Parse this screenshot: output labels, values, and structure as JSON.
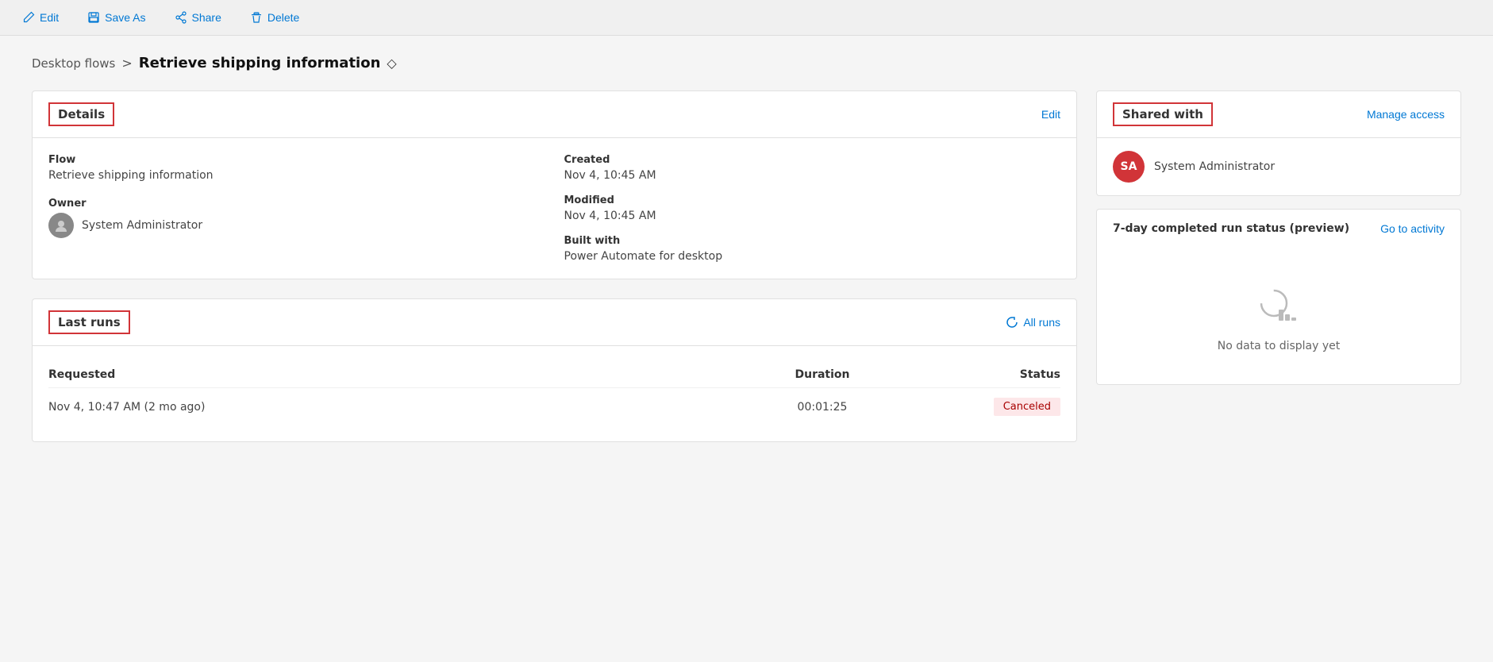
{
  "toolbar": {
    "edit_label": "Edit",
    "save_as_label": "Save As",
    "share_label": "Share",
    "delete_label": "Delete"
  },
  "breadcrumb": {
    "parent_label": "Desktop flows",
    "separator": ">",
    "current_label": "Retrieve shipping information"
  },
  "details_card": {
    "title": "Details",
    "edit_link": "Edit",
    "flow_label": "Flow",
    "flow_value": "Retrieve shipping information",
    "owner_label": "Owner",
    "owner_value": "System Administrator",
    "created_label": "Created",
    "created_value": "Nov 4, 10:45 AM",
    "modified_label": "Modified",
    "modified_value": "Nov 4, 10:45 AM",
    "built_with_label": "Built with",
    "built_with_value": "Power Automate for desktop"
  },
  "last_runs_card": {
    "title": "Last runs",
    "all_runs_link": "All runs",
    "columns": {
      "requested": "Requested",
      "duration": "Duration",
      "status": "Status"
    },
    "rows": [
      {
        "requested": "Nov 4, 10:47 AM (2 mo ago)",
        "duration": "00:01:25",
        "status": "Canceled"
      }
    ]
  },
  "shared_with_card": {
    "title": "Shared with",
    "manage_access_link": "Manage access",
    "user_initials": "SA",
    "user_name": "System Administrator"
  },
  "run_status_section": {
    "title": "7-day completed run status (preview)",
    "go_to_activity_link": "Go to activity",
    "no_data_text": "No data to display yet"
  }
}
